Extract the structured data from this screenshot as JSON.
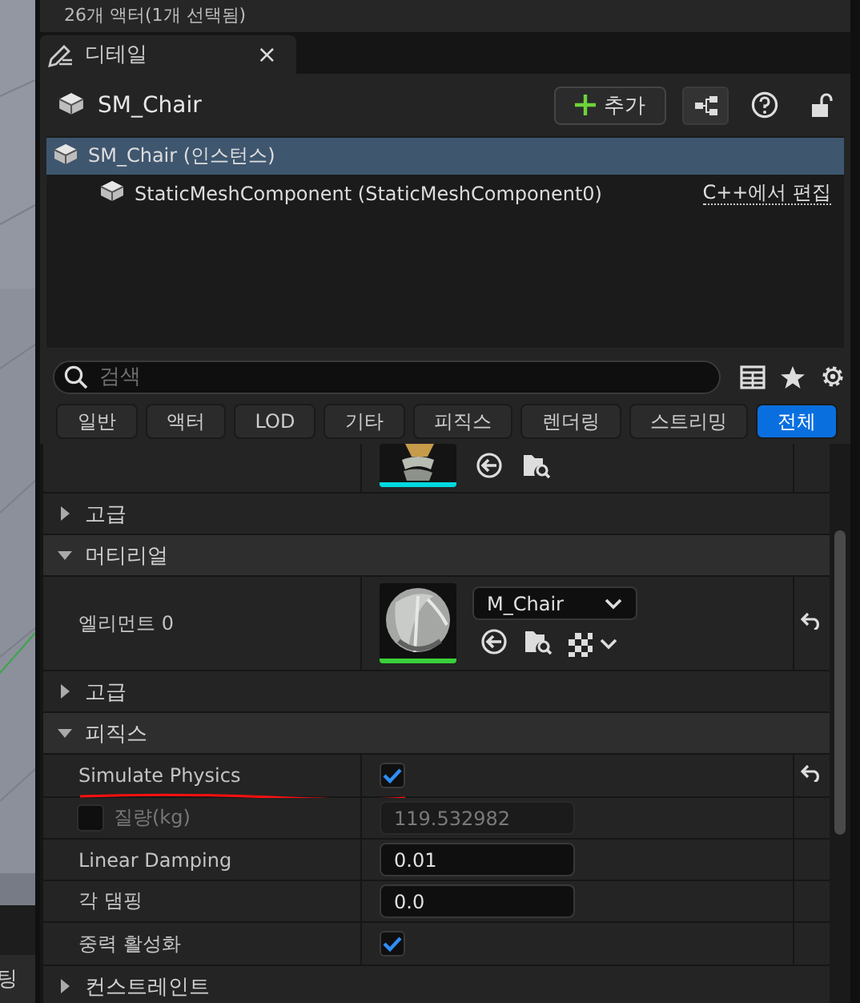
{
  "outliner_footer": {
    "text": "26개 액터(1개 선택됨)"
  },
  "side_panel": {
    "tab_label": "팅"
  },
  "details_tab": {
    "title": "디테일",
    "close": "×"
  },
  "header": {
    "name": "SM_Chair",
    "add_button": "추가"
  },
  "components": [
    {
      "label": "SM_Chair (인스턴스)",
      "selected": true,
      "children": [
        {
          "label": "StaticMeshComponent (StaticMeshComponent0)",
          "selected": false,
          "edit_link": "C++에서 편집"
        }
      ]
    }
  ],
  "search": {
    "placeholder": "검색"
  },
  "filters": [
    {
      "label": "일반",
      "selected": false
    },
    {
      "label": "액터",
      "selected": false
    },
    {
      "label": "LOD",
      "selected": false
    },
    {
      "label": "기타",
      "selected": false
    },
    {
      "label": "피직스",
      "selected": false
    },
    {
      "label": "렌더링",
      "selected": false
    },
    {
      "label": "스트리밍",
      "selected": false
    },
    {
      "label": "전체",
      "selected": true
    }
  ],
  "properties": [
    {
      "kind": "asset",
      "color": "#00d8e0"
    },
    {
      "kind": "group",
      "label": "고급",
      "expanded": false
    },
    {
      "kind": "section",
      "label": "머티리얼",
      "expanded": true
    },
    {
      "kind": "material",
      "label": "엘리먼트 0",
      "asset": "M_Chair",
      "color": "#3ad03a",
      "reset": true
    },
    {
      "kind": "group",
      "label": "고급",
      "expanded": false
    },
    {
      "kind": "section",
      "label": "피직스",
      "expanded": true
    },
    {
      "kind": "checkbox",
      "label": "Simulate Physics",
      "checked": true,
      "reset": true,
      "underlined": true
    },
    {
      "kind": "number",
      "label": "질량(kg)",
      "value": "119.532982",
      "disabled": true,
      "override_checked": false
    },
    {
      "kind": "number",
      "label": "Linear Damping",
      "value": "0.01",
      "disabled": false
    },
    {
      "kind": "number",
      "label": "각 댐핑",
      "value": "0.0",
      "disabled": false
    },
    {
      "kind": "checkbox",
      "label": "중력 활성화",
      "checked": true
    },
    {
      "kind": "group",
      "label": "컨스트레인트",
      "expanded": false
    }
  ]
}
